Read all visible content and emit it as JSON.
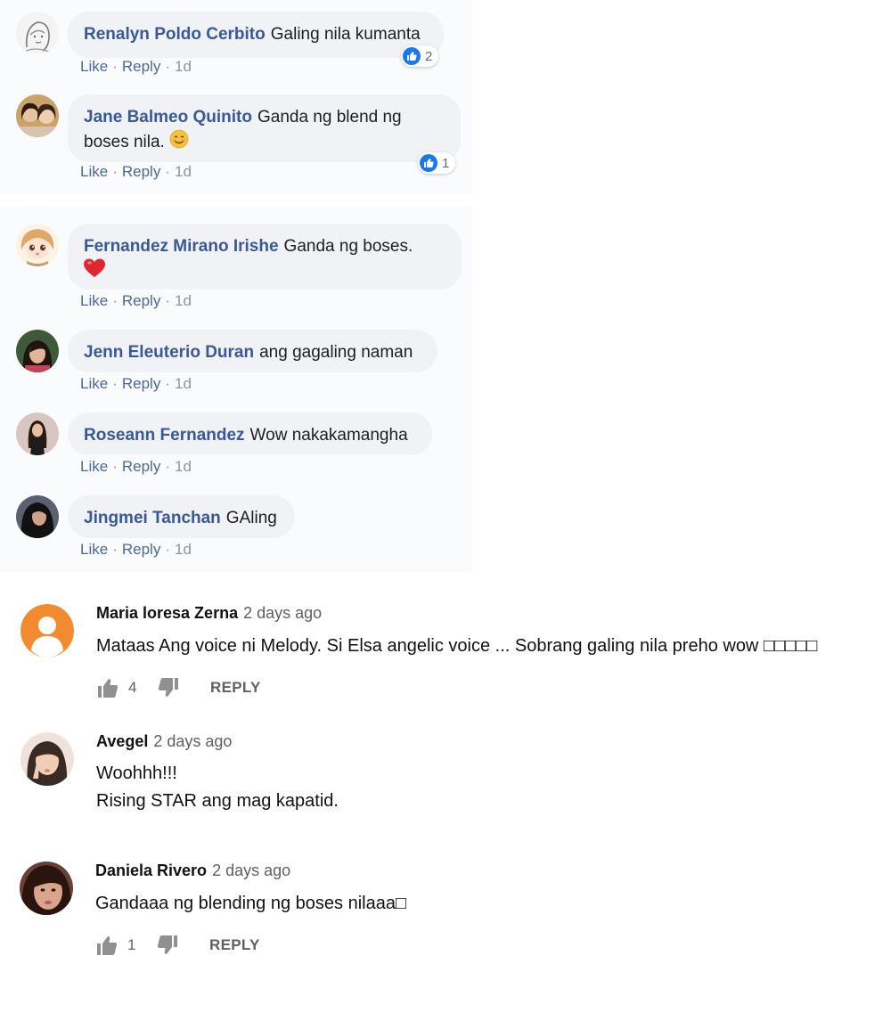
{
  "facebook": {
    "comments": [
      {
        "name": "Renalyn Poldo Cerbito",
        "text": "Galing nila kumanta",
        "like_label": "Like",
        "reply_label": "Reply",
        "time": "1d",
        "reactions": "2",
        "avatar": "sketch-girl-avatar"
      },
      {
        "name": "Jane Balmeo Quinito",
        "text": "Ganda ng blend ng",
        "text_line2": "boses nila.",
        "emoji": "smiling-face-emoji",
        "like_label": "Like",
        "reply_label": "Reply",
        "time": "1d",
        "reactions": "1",
        "avatar": "two-girls-photo-avatar"
      },
      {
        "name": "Fernandez Mirano Irishe",
        "text": "Ganda ng boses.",
        "emoji": "red-heart-emoji",
        "like_label": "Like",
        "reply_label": "Reply",
        "time": "1d",
        "avatar": "anime-doll-avatar"
      },
      {
        "name": "Jenn Eleuterio Duran",
        "text": "ang gagaling naman",
        "like_label": "Like",
        "reply_label": "Reply",
        "time": "1d",
        "avatar": "girl-photo-avatar"
      },
      {
        "name": "Roseann Fernandez",
        "text": "Wow nakakamangha",
        "like_label": "Like",
        "reply_label": "Reply",
        "time": "1d",
        "avatar": "girl-standing-photo-avatar"
      },
      {
        "name": "Jingmei Tanchan",
        "text": "GAling",
        "like_label": "Like",
        "reply_label": "Reply",
        "time": "1d",
        "avatar": "dark-hair-photo-avatar"
      }
    ]
  },
  "youtube": {
    "comments": [
      {
        "author": "Maria loresa Zerna",
        "time": "2 days ago",
        "text": "Mataas Ang voice ni Melody. Si Elsa angelic voice ... Sobrang galing nila preho wow □□□□□",
        "likes": "4",
        "reply_label": "REPLY",
        "avatar": "default-orange-person-avatar"
      },
      {
        "author": "Avegel",
        "time": "2 days ago",
        "text": "Woohhh!!!",
        "text_line2": "Rising STAR ang mag kapatid.",
        "avatar": "peace-sign-girl-avatar"
      },
      {
        "author": "Daniela Rivero",
        "time": "2 days ago",
        "text": "Gandaaa ng blending ng boses nilaaa□",
        "likes": "1",
        "reply_label": "REPLY",
        "avatar": "girl-closeup-avatar"
      }
    ]
  },
  "colors": {
    "fb_name": "#385898",
    "fb_bubble": "#f0f2f5",
    "fb_like_blue": "#1877f2",
    "yt_default_avatar": "#f28b30"
  }
}
